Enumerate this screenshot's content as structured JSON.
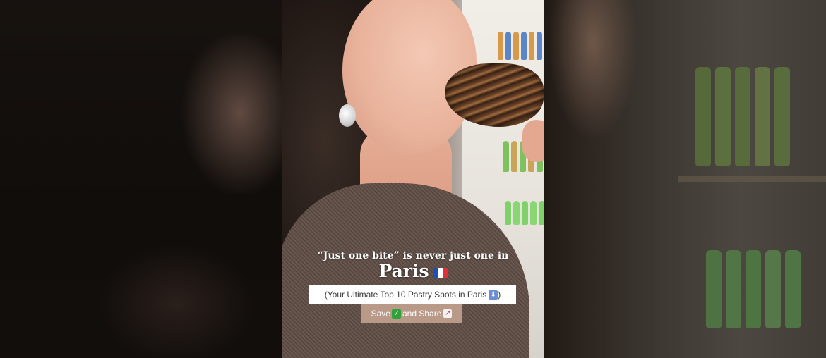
{
  "caption": {
    "headline": "“Just one bite” is never just one in",
    "city": "Paris",
    "subtitle_prefix": "(Your Ultimate Top 10 Pastry Spots in Paris",
    "subtitle_suffix": ")",
    "save_text": "Save",
    "share_text": "and Share"
  },
  "icons": {
    "flag": "france-flag-icon",
    "down": "down-arrow-icon",
    "check": "check-mark-icon",
    "chart": "chart-increasing-icon"
  },
  "colors": {
    "caption_box": "#ffffff",
    "save_box": "#b99a89"
  }
}
